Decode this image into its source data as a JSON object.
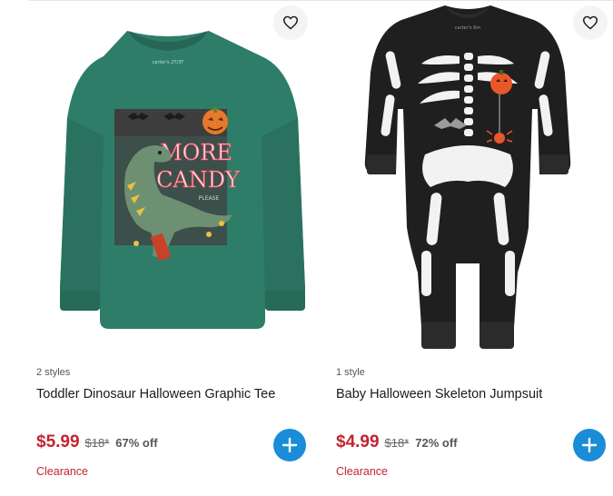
{
  "products": [
    {
      "styles": "2 styles",
      "name": "Toddler Dinosaur Halloween Graphic Tee",
      "price": "$5.99",
      "was_price": "$18*",
      "discount": "67% off",
      "badge": "Clearance",
      "image_alt": "Green long-sleeve tee with dinosaur and \"MORE CANDY PLEASE\" graphic",
      "graphic_text": [
        "MORE",
        "CANDY",
        "PLEASE"
      ],
      "tag_text": "carter's 2T/3T",
      "colors": {
        "shirt": "#2e7d68",
        "pumpkin": "#e8782a"
      }
    },
    {
      "styles": "1 style",
      "name": "Baby Halloween Skeleton Jumpsuit",
      "price": "$4.99",
      "was_price": "$18*",
      "discount": "72% off",
      "badge": "Clearance",
      "image_alt": "Black long-sleeve jumpsuit with white skeleton print",
      "tag_text": "carter's 6m",
      "colors": {
        "suit": "#1f1f1f",
        "bones": "#f2f2f2",
        "pumpkin": "#e8572a"
      }
    }
  ],
  "icons": {
    "favorite": "heart-outline-icon",
    "add": "plus-icon"
  },
  "colors": {
    "accent": "#1a8cd8",
    "sale": "#c4232f"
  }
}
